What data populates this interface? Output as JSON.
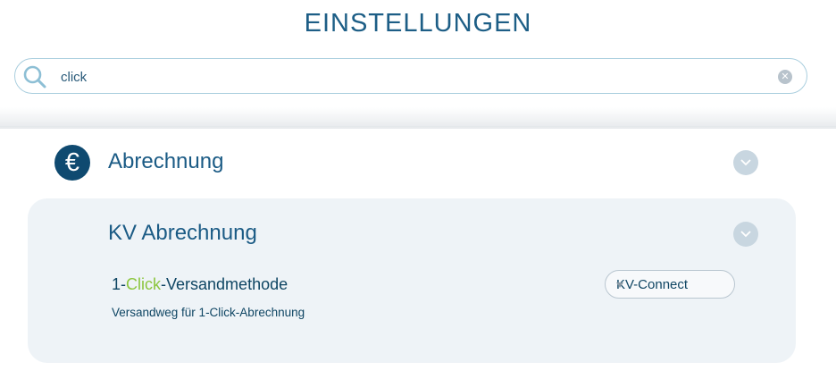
{
  "header": {
    "title": "EINSTELLUNGEN"
  },
  "search": {
    "value": "click",
    "placeholder": ""
  },
  "section": {
    "icon": "euro-icon",
    "icon_glyph": "€",
    "title": "Abrechnung"
  },
  "subsection": {
    "title": "KV Abrechnung",
    "setting": {
      "label_prefix": "1-",
      "label_highlight": "Click",
      "label_suffix": "-Versandmethode",
      "description": "Versandweg für 1-Click-Abrechnung",
      "selected_value": "KV-Connect"
    }
  },
  "colors": {
    "brand": "#0f4a70",
    "highlight": "#8cc63e",
    "panel_bg": "#eef3f7"
  }
}
